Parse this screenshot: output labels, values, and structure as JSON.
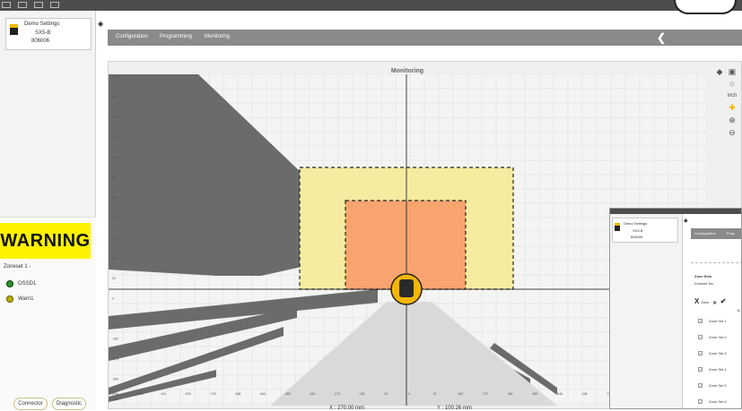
{
  "device": {
    "name": "Demo Settings",
    "model": "SX5-B",
    "serial": "806006"
  },
  "nav": {
    "tabs": [
      "Configuration",
      "Programming",
      "Monitoring"
    ]
  },
  "monitoring": {
    "title": "Monitoring",
    "coord_x": "X : 270.00 mm",
    "coord_y": "Y : 100.26 mm",
    "units_label": "inch",
    "y_ticks": [
      "1008",
      "908",
      "816",
      "707",
      "614",
      "551",
      "470",
      "364",
      "272",
      "181",
      "91",
      "0",
      "-91",
      "-182",
      "-273",
      "-364",
      "-455"
    ],
    "x_ticks": [
      "-1094",
      "-1003",
      "-911",
      "-820",
      "-729",
      "-638",
      "-546",
      "-455",
      "-364",
      "-273",
      "-182",
      "-91",
      "0",
      "91",
      "182",
      "273",
      "364",
      "455",
      "546",
      "638",
      "727",
      "818",
      "909"
    ],
    "colors": {
      "warning_zone": "#f5eca0",
      "protective_zone": "#f7a46e",
      "shadow": "#6b6b6b",
      "field": "#d9d9d9"
    }
  },
  "status": {
    "warning": "WARNING",
    "zoneset": "Zoneset 1 -",
    "outputs": [
      {
        "label": "OSSD1",
        "color": "#2e8b2e"
      },
      {
        "label": "Warn1",
        "color": "#b9b000"
      }
    ]
  },
  "buttons": {
    "connector": "Connector",
    "diagnostic": "Diagnostic"
  },
  "inset": {
    "device": {
      "name": "Demo Settings",
      "model": "SX5-B",
      "serial": "806006"
    },
    "nav": {
      "tab1": "Configuration",
      "tab2": "Prog"
    },
    "zone_sets_title": "Zone Sets",
    "zoneset_no": "Zoneset No.",
    "toolbar_zone": "Zone",
    "col_a": "A",
    "zone_sets": [
      "Zone Set 1",
      "Zone Set 2",
      "Zone Set 3",
      "Zone Set 4",
      "Zone Set 5",
      "Zone Set 6"
    ]
  }
}
